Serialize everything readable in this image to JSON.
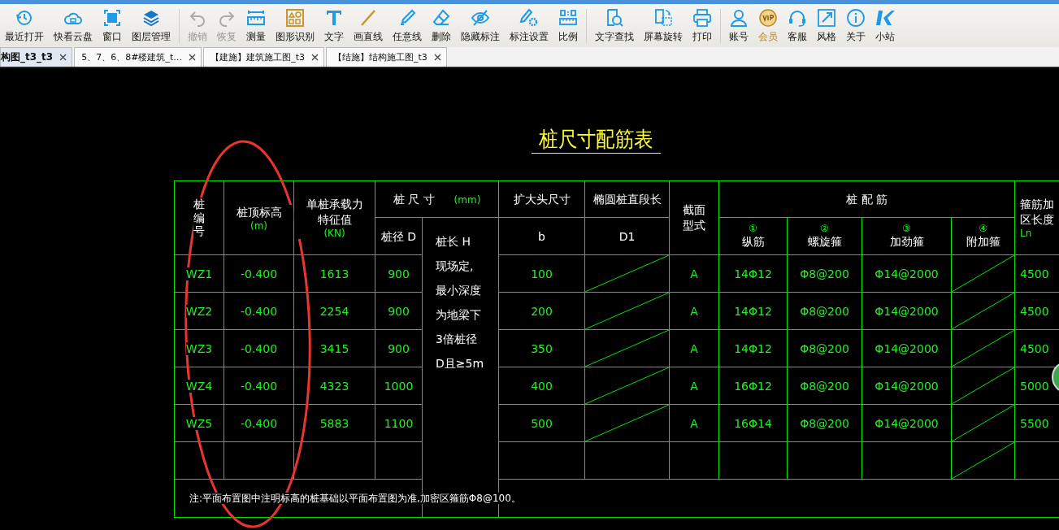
{
  "toolbar": {
    "groups": [
      [
        {
          "label": "最近打开",
          "kind": "clock",
          "disabled": false
        },
        {
          "label": "快看云盘",
          "kind": "cloud",
          "disabled": false
        },
        {
          "label": "窗口",
          "kind": "window",
          "disabled": false
        },
        {
          "label": "图层管理",
          "kind": "layers",
          "disabled": false
        }
      ],
      [
        {
          "label": "撤销",
          "kind": "undo",
          "disabled": true
        },
        {
          "label": "恢复",
          "kind": "redo",
          "disabled": true
        },
        {
          "label": "测量",
          "kind": "ruler",
          "disabled": false
        },
        {
          "label": "图形识别",
          "kind": "shapes",
          "disabled": false
        },
        {
          "label": "文字",
          "kind": "text",
          "disabled": false
        },
        {
          "label": "画直线",
          "kind": "line",
          "disabled": false
        },
        {
          "label": "任意线",
          "kind": "pen",
          "disabled": false
        },
        {
          "label": "删除",
          "kind": "eraser",
          "disabled": false
        },
        {
          "label": "隐藏标注",
          "kind": "eye-off",
          "disabled": false
        },
        {
          "label": "标注设置",
          "kind": "pen-gear",
          "disabled": false
        },
        {
          "label": "比例",
          "kind": "scale",
          "disabled": false
        }
      ],
      [
        {
          "label": "文字查找",
          "kind": "find-text",
          "disabled": false
        },
        {
          "label": "屏幕旋转",
          "kind": "rotate",
          "disabled": false
        },
        {
          "label": "打印",
          "kind": "printer",
          "disabled": false
        }
      ],
      [
        {
          "label": "账号",
          "kind": "person",
          "disabled": false
        },
        {
          "label": "会员",
          "kind": "vip",
          "disabled": false
        },
        {
          "label": "客服",
          "kind": "headset",
          "disabled": false
        },
        {
          "label": "风格",
          "kind": "resize",
          "disabled": false
        },
        {
          "label": "关于",
          "kind": "info",
          "disabled": false
        },
        {
          "label": "小站",
          "kind": "k-logo",
          "disabled": false
        }
      ]
    ]
  },
  "tabs": [
    {
      "label": "构图_t3_t3",
      "selected": true
    },
    {
      "label": "5、7、6、8#楼建筑_t…",
      "selected": false
    },
    {
      "label": "【建施】建筑施工图_t3",
      "selected": false
    },
    {
      "label": "【结施】结构施工图_t3",
      "selected": false
    }
  ],
  "drawing": {
    "title": "桩尺寸配筋表",
    "header": {
      "pile_no": "桩编号",
      "top_elev": "桩顶标高",
      "top_elev_unit": "(m)",
      "capacity": [
        "单桩承载力",
        "特征值"
      ],
      "capacity_unit": "(KN)",
      "pile_size": "桩 尺 寸",
      "pile_size_unit": "(mm)",
      "enlarged_head": "扩大头尺寸",
      "ellipse_len": "椭圆桩直段长",
      "section": [
        "截面",
        "型式"
      ],
      "reinforcement": "桩 配 筋",
      "dense_len": [
        "箍筋加",
        "区长度"
      ],
      "dense_len_unit": "Ln",
      "diameter": "桩径 D",
      "length": [
        "桩长 H",
        "现场定,",
        "最小深度",
        "为地梁下",
        "3倍桩径",
        "D且≥5m"
      ],
      "b": "b",
      "d1": "D1",
      "bars": [
        {
          "no": "①",
          "label": "纵筋"
        },
        {
          "no": "②",
          "label": "螺旋箍"
        },
        {
          "no": "③",
          "label": "加劲箍"
        },
        {
          "no": "④",
          "label": "附加箍"
        }
      ]
    },
    "rows": [
      {
        "id": "WZ1",
        "elevation": "-0.400",
        "capacity": "1613",
        "diameter": "900",
        "b": "100",
        "d1_struck": true,
        "section": "A",
        "long_bar": "14Φ12",
        "spiral": "Φ8@200",
        "stiffener": "Φ14@2000",
        "extra_struck": true,
        "ln": "4500"
      },
      {
        "id": "WZ2",
        "elevation": "-0.400",
        "capacity": "2254",
        "diameter": "900",
        "b": "200",
        "d1_struck": true,
        "section": "A",
        "long_bar": "14Φ12",
        "spiral": "Φ8@200",
        "stiffener": "Φ14@2000",
        "extra_struck": true,
        "ln": "4500"
      },
      {
        "id": "WZ3",
        "elevation": "-0.400",
        "capacity": "3415",
        "diameter": "900",
        "b": "350",
        "d1_struck": true,
        "section": "A",
        "long_bar": "14Φ12",
        "spiral": "Φ8@200",
        "stiffener": "Φ14@2000",
        "extra_struck": true,
        "ln": "4500"
      },
      {
        "id": "WZ4",
        "elevation": "-0.400",
        "capacity": "4323",
        "diameter": "1000",
        "b": "400",
        "d1_struck": true,
        "section": "A",
        "long_bar": "16Φ12",
        "spiral": "Φ8@200",
        "stiffener": "Φ14@2000",
        "extra_struck": true,
        "ln": "5000"
      },
      {
        "id": "WZ5",
        "elevation": "-0.400",
        "capacity": "5883",
        "diameter": "1100",
        "b": "500",
        "d1_struck": true,
        "section": "A",
        "long_bar": "16Φ14",
        "spiral": "Φ8@200",
        "stiffener": "Φ14@2000",
        "extra_struck": true,
        "ln": "5500"
      },
      {
        "d1_struck": false,
        "extra_struck": true
      }
    ],
    "note": "注:平面布置图中注明标高的桩基础以平面布置图为准,加密区箍筋Φ8@100。"
  }
}
